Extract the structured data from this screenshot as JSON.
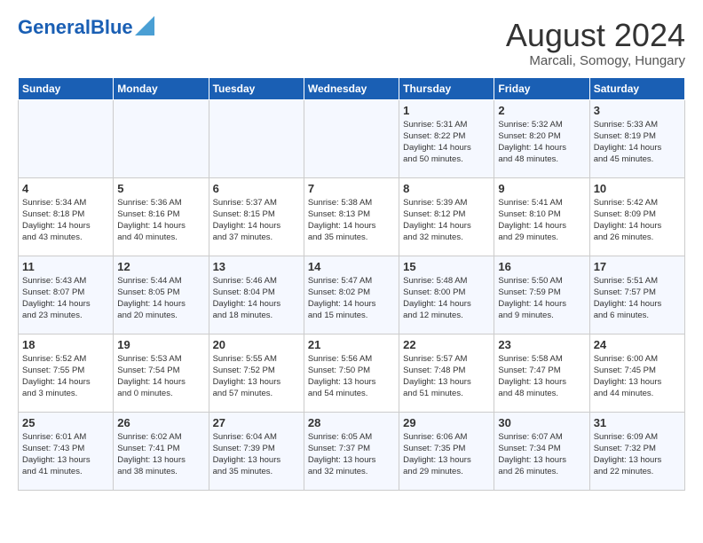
{
  "header": {
    "logo_general": "General",
    "logo_blue": "Blue",
    "month": "August 2024",
    "location": "Marcali, Somogy, Hungary"
  },
  "weekdays": [
    "Sunday",
    "Monday",
    "Tuesday",
    "Wednesday",
    "Thursday",
    "Friday",
    "Saturday"
  ],
  "weeks": [
    [
      {
        "day": "",
        "info": ""
      },
      {
        "day": "",
        "info": ""
      },
      {
        "day": "",
        "info": ""
      },
      {
        "day": "",
        "info": ""
      },
      {
        "day": "1",
        "info": "Sunrise: 5:31 AM\nSunset: 8:22 PM\nDaylight: 14 hours\nand 50 minutes."
      },
      {
        "day": "2",
        "info": "Sunrise: 5:32 AM\nSunset: 8:20 PM\nDaylight: 14 hours\nand 48 minutes."
      },
      {
        "day": "3",
        "info": "Sunrise: 5:33 AM\nSunset: 8:19 PM\nDaylight: 14 hours\nand 45 minutes."
      }
    ],
    [
      {
        "day": "4",
        "info": "Sunrise: 5:34 AM\nSunset: 8:18 PM\nDaylight: 14 hours\nand 43 minutes."
      },
      {
        "day": "5",
        "info": "Sunrise: 5:36 AM\nSunset: 8:16 PM\nDaylight: 14 hours\nand 40 minutes."
      },
      {
        "day": "6",
        "info": "Sunrise: 5:37 AM\nSunset: 8:15 PM\nDaylight: 14 hours\nand 37 minutes."
      },
      {
        "day": "7",
        "info": "Sunrise: 5:38 AM\nSunset: 8:13 PM\nDaylight: 14 hours\nand 35 minutes."
      },
      {
        "day": "8",
        "info": "Sunrise: 5:39 AM\nSunset: 8:12 PM\nDaylight: 14 hours\nand 32 minutes."
      },
      {
        "day": "9",
        "info": "Sunrise: 5:41 AM\nSunset: 8:10 PM\nDaylight: 14 hours\nand 29 minutes."
      },
      {
        "day": "10",
        "info": "Sunrise: 5:42 AM\nSunset: 8:09 PM\nDaylight: 14 hours\nand 26 minutes."
      }
    ],
    [
      {
        "day": "11",
        "info": "Sunrise: 5:43 AM\nSunset: 8:07 PM\nDaylight: 14 hours\nand 23 minutes."
      },
      {
        "day": "12",
        "info": "Sunrise: 5:44 AM\nSunset: 8:05 PM\nDaylight: 14 hours\nand 20 minutes."
      },
      {
        "day": "13",
        "info": "Sunrise: 5:46 AM\nSunset: 8:04 PM\nDaylight: 14 hours\nand 18 minutes."
      },
      {
        "day": "14",
        "info": "Sunrise: 5:47 AM\nSunset: 8:02 PM\nDaylight: 14 hours\nand 15 minutes."
      },
      {
        "day": "15",
        "info": "Sunrise: 5:48 AM\nSunset: 8:00 PM\nDaylight: 14 hours\nand 12 minutes."
      },
      {
        "day": "16",
        "info": "Sunrise: 5:50 AM\nSunset: 7:59 PM\nDaylight: 14 hours\nand 9 minutes."
      },
      {
        "day": "17",
        "info": "Sunrise: 5:51 AM\nSunset: 7:57 PM\nDaylight: 14 hours\nand 6 minutes."
      }
    ],
    [
      {
        "day": "18",
        "info": "Sunrise: 5:52 AM\nSunset: 7:55 PM\nDaylight: 14 hours\nand 3 minutes."
      },
      {
        "day": "19",
        "info": "Sunrise: 5:53 AM\nSunset: 7:54 PM\nDaylight: 14 hours\nand 0 minutes."
      },
      {
        "day": "20",
        "info": "Sunrise: 5:55 AM\nSunset: 7:52 PM\nDaylight: 13 hours\nand 57 minutes."
      },
      {
        "day": "21",
        "info": "Sunrise: 5:56 AM\nSunset: 7:50 PM\nDaylight: 13 hours\nand 54 minutes."
      },
      {
        "day": "22",
        "info": "Sunrise: 5:57 AM\nSunset: 7:48 PM\nDaylight: 13 hours\nand 51 minutes."
      },
      {
        "day": "23",
        "info": "Sunrise: 5:58 AM\nSunset: 7:47 PM\nDaylight: 13 hours\nand 48 minutes."
      },
      {
        "day": "24",
        "info": "Sunrise: 6:00 AM\nSunset: 7:45 PM\nDaylight: 13 hours\nand 44 minutes."
      }
    ],
    [
      {
        "day": "25",
        "info": "Sunrise: 6:01 AM\nSunset: 7:43 PM\nDaylight: 13 hours\nand 41 minutes."
      },
      {
        "day": "26",
        "info": "Sunrise: 6:02 AM\nSunset: 7:41 PM\nDaylight: 13 hours\nand 38 minutes."
      },
      {
        "day": "27",
        "info": "Sunrise: 6:04 AM\nSunset: 7:39 PM\nDaylight: 13 hours\nand 35 minutes."
      },
      {
        "day": "28",
        "info": "Sunrise: 6:05 AM\nSunset: 7:37 PM\nDaylight: 13 hours\nand 32 minutes."
      },
      {
        "day": "29",
        "info": "Sunrise: 6:06 AM\nSunset: 7:35 PM\nDaylight: 13 hours\nand 29 minutes."
      },
      {
        "day": "30",
        "info": "Sunrise: 6:07 AM\nSunset: 7:34 PM\nDaylight: 13 hours\nand 26 minutes."
      },
      {
        "day": "31",
        "info": "Sunrise: 6:09 AM\nSunset: 7:32 PM\nDaylight: 13 hours\nand 22 minutes."
      }
    ]
  ]
}
